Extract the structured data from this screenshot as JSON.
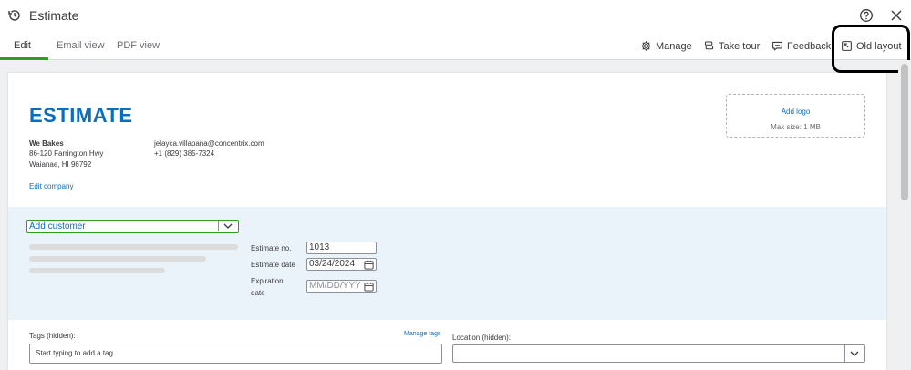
{
  "window": {
    "title": "Estimate"
  },
  "tabs": [
    {
      "label": "Edit",
      "active": true
    },
    {
      "label": "Email view",
      "active": false
    },
    {
      "label": "PDF view",
      "active": false
    }
  ],
  "toolbar": {
    "manage_label": "Manage",
    "tour_label": "Take tour",
    "feedback_label": "Feedback",
    "old_layout_label": "Old layout"
  },
  "document": {
    "heading": "ESTIMATE",
    "company": {
      "name": "We Bakes",
      "address_line1": "86-120 Farrington Hwy",
      "address_line2": "Waianae, HI 96792",
      "email": "jelayca.villapana@concentrix.com",
      "phone": "+1 (829) 385-7324",
      "edit_link": "Edit company"
    },
    "logo": {
      "add_label": "Add logo",
      "max_size": "Max size: 1 MB"
    },
    "customer": {
      "placeholder": "Add customer"
    },
    "fields": {
      "estimate_no_label": "Estimate no.",
      "estimate_no_value": "1013",
      "estimate_date_label": "Estimate date",
      "estimate_date_value": "03/24/2024",
      "expiration_label_line1": "Expiration",
      "expiration_label_line2": "date",
      "expiration_placeholder": "MM/DD/YYY"
    },
    "tags": {
      "label": "Tags (hidden):",
      "manage_link": "Manage tags",
      "placeholder": "Start typing to add a tag"
    },
    "location": {
      "label": "Location (hidden):"
    }
  },
  "colors": {
    "brand_blue": "#0a6ebd",
    "accent_green": "#2ca01c",
    "panel_blue": "#eaf3fa"
  }
}
